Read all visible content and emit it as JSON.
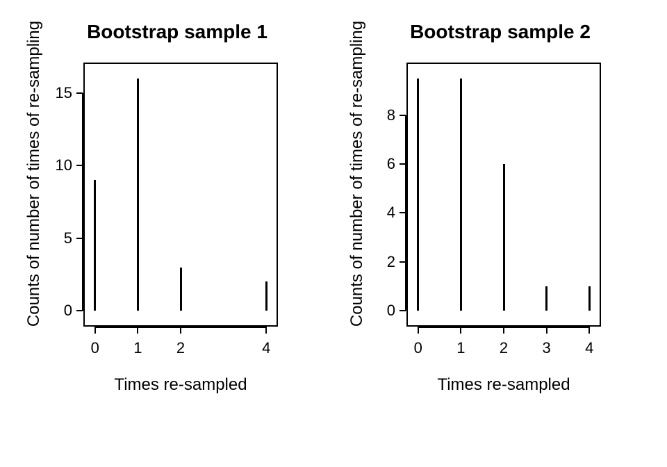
{
  "chart_data": [
    {
      "type": "bar",
      "title": "Bootstrap sample 1",
      "xlabel": "Times re-sampled",
      "ylabel": "Counts of number of times of re-sampling",
      "categories": [
        0,
        1,
        2,
        4
      ],
      "values": [
        9,
        16,
        3,
        2
      ],
      "xlim": [
        0,
        4
      ],
      "ylim": [
        0,
        16
      ],
      "xticks": [
        0,
        1,
        2,
        4
      ],
      "yticks": [
        0,
        5,
        10,
        15
      ]
    },
    {
      "type": "bar",
      "title": "Bootstrap sample 2",
      "xlabel": "Times re-sampled",
      "ylabel": "Counts of number of times of re-sampling",
      "categories": [
        0,
        1,
        2,
        3,
        4
      ],
      "values": [
        9.5,
        9.5,
        6,
        1,
        1
      ],
      "xlim": [
        0,
        4
      ],
      "ylim": [
        0,
        9.5
      ],
      "xticks": [
        0,
        1,
        2,
        3,
        4
      ],
      "yticks": [
        0,
        2,
        4,
        6,
        8
      ]
    }
  ]
}
